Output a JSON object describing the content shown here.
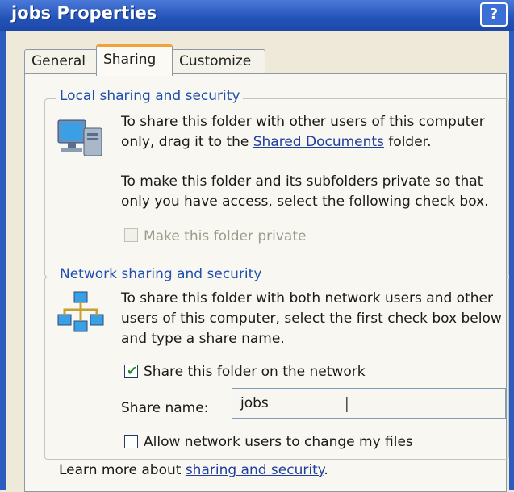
{
  "window": {
    "title": "jobs Properties",
    "help_label": "?"
  },
  "tabs": [
    {
      "label": "General"
    },
    {
      "label": "Sharing"
    },
    {
      "label": "Customize"
    }
  ],
  "local_group": {
    "legend": "Local sharing and security",
    "line1": "To share this folder with other users of this computer",
    "line2_prefix": "only, drag it to the ",
    "line2_link": "Shared Documents",
    "line2_suffix": " folder.",
    "line3": "To make this folder and its subfolders private so that",
    "line4": "only you have access, select the following check box.",
    "private_checkbox_label": "Make this folder private",
    "private_checked": false,
    "private_disabled": true
  },
  "network_group": {
    "legend": "Network sharing and security",
    "line1": "To share this folder with both network users and other",
    "line2": "users of this computer, select the first check box below",
    "line3": "and type a share name.",
    "share_checkbox_label": "Share this folder on the network",
    "share_checked": true,
    "share_name_label": "Share name:",
    "share_name_value": "jobs",
    "allow_change_label": "Allow network users to change my files",
    "allow_change_checked": false
  },
  "footer": {
    "prefix": "Learn more about ",
    "link": "sharing and security",
    "suffix": "."
  },
  "icons": {
    "local": "computer-icon",
    "network": "network-icon",
    "cursor": "text-cursor-icon"
  }
}
